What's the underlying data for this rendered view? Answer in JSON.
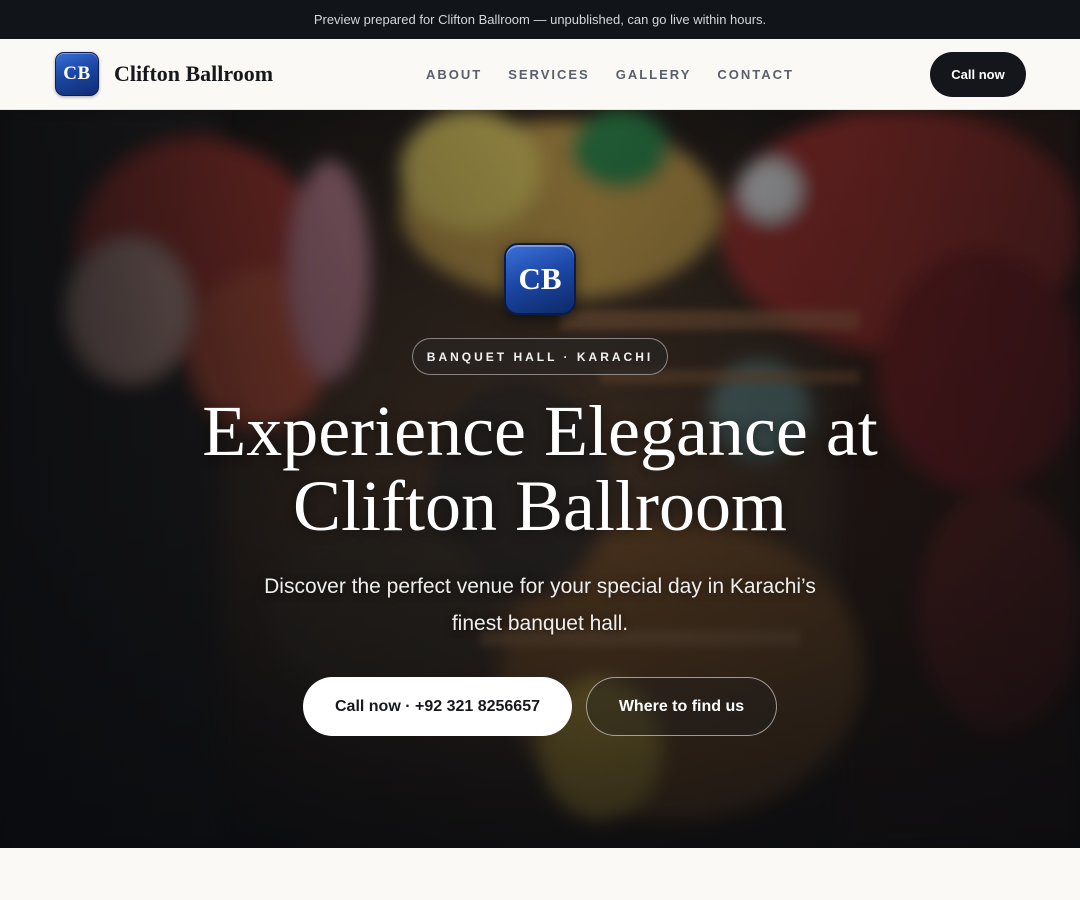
{
  "preview_banner": {
    "text": "Preview prepared for Clifton Ballroom — unpublished, can go live within hours."
  },
  "header": {
    "logo_initials": "CB",
    "brand_name": "Clifton Ballroom",
    "nav": [
      {
        "label": "ABOUT"
      },
      {
        "label": "SERVICES"
      },
      {
        "label": "GALLERY"
      },
      {
        "label": "CONTACT"
      }
    ],
    "cta_label": "Call now"
  },
  "hero": {
    "logo_initials": "CB",
    "eyebrow": "BANQUET HALL · KARACHI",
    "title_line1": "Experience Elegance at",
    "title_line2": "Clifton Ballroom",
    "subtitle": "Discover the perfect venue for your special day in Karachi’s finest banquet hall.",
    "primary_button": "Call now · +92 321 8256657",
    "secondary_button": "Where to find us",
    "background_image": "market-stall-photo"
  },
  "colors": {
    "accent_dark": "#14161b",
    "logo_blue": "#1c47a6",
    "page_background": "#faf9f6"
  }
}
